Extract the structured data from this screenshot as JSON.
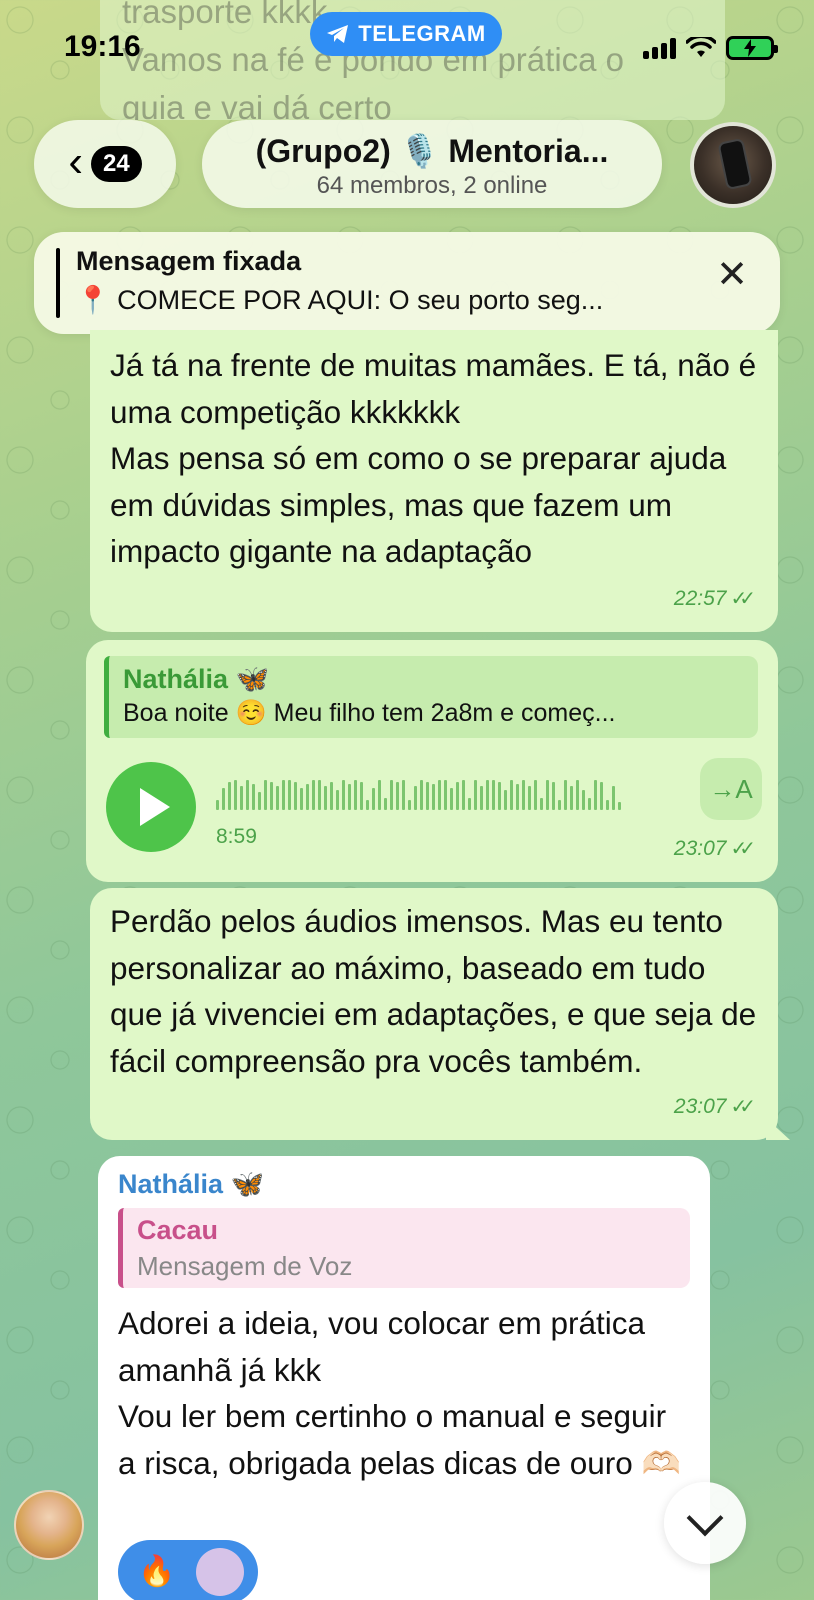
{
  "status_bar": {
    "time": "19:16",
    "app_pill": "TELEGRAM"
  },
  "background_message": {
    "lines": [
      "trasporte kkkk",
      "Vamos na fé e pondo em prática o",
      "guia e vai dá certo"
    ]
  },
  "header": {
    "back_count": "24",
    "title": "(Grupo2) 🎙️ Mentoria...",
    "subtitle": "64 membros, 2 online"
  },
  "pinned": {
    "label": "Mensagem fixada",
    "text": "📍 COMECE POR AQUI: O seu porto seg..."
  },
  "messages": [
    {
      "text": "Já tá na frente de muitas mamães. E tá, não é uma competição kkkkkkk\nMas pensa só em como o se preparar ajuda em dúvidas simples, mas que fazem um impacto gigante na adaptação",
      "time": "22:57"
    },
    {
      "reply_name": "Nathália 🦋",
      "reply_text": "Boa noite ☺️ Meu filho tem 2a8m e começ...",
      "voice_duration": "8:59",
      "transcribe_label": "→A",
      "time": "23:07"
    },
    {
      "text": "Perdão pelos áudios imensos. Mas eu tento personalizar ao máximo, baseado em tudo que já vivenciei em adaptações, e que seja de fácil compreensão pra vocês também.",
      "time": "23:07"
    },
    {
      "sender": "Nathália 🦋",
      "quote_name": "Cacau",
      "quote_text": "Mensagem de Voz",
      "text": "Adorei a ideia, vou colocar em prática amanhã já kkk\nVou ler bem certinho o manual e seguir a risca, obrigada pelas dicas de ouro 🫶🏻",
      "reaction": "🔥"
    }
  ],
  "colors": {
    "accent": "#2f8ef5",
    "outgoing_bubble": "#e0f8c8",
    "incoming_bubble": "#ffffff",
    "time_green": "#4ca24a"
  },
  "icons": [
    "telegram-icon",
    "signal-icon",
    "wifi-icon",
    "battery-charging-icon",
    "back-chevron-icon",
    "close-icon",
    "play-icon",
    "transcribe-icon",
    "double-check-icon",
    "chevron-down-icon"
  ]
}
